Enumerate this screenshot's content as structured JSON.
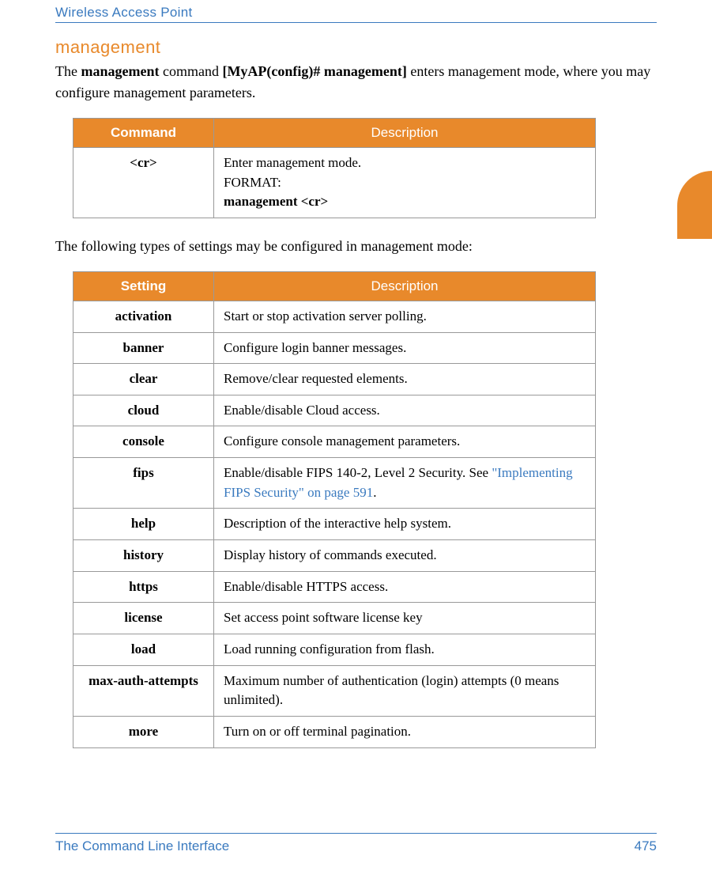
{
  "header": {
    "title": "Wireless Access Point"
  },
  "section": {
    "heading": "management",
    "intro_parts": [
      "The ",
      "management",
      " command ",
      "[MyAP(config)# management]",
      " enters management mode, where you may configure management parameters."
    ]
  },
  "table1": {
    "head": {
      "c1": "Command",
      "c2": "Description"
    },
    "row": {
      "name": "<cr>",
      "desc_line": "Enter management mode.",
      "fmt_label": "FORMAT:",
      "fmt_value": "management <cr>"
    }
  },
  "between_text": "The following types of settings may be configured in management mode:",
  "table2": {
    "head": {
      "c1": "Setting",
      "c2": "Description"
    },
    "rows": [
      {
        "name": "activation",
        "desc": "Start or stop activation server polling."
      },
      {
        "name": "banner",
        "desc": "Configure login banner messages."
      },
      {
        "name": "clear",
        "desc": "Remove/clear requested elements."
      },
      {
        "name": "cloud",
        "desc": "Enable/disable Cloud access."
      },
      {
        "name": "console",
        "desc": "Configure console management parameters."
      },
      {
        "name": "fips",
        "desc": "Enable/disable FIPS 140-2, Level 2 Security. See ",
        "link": "\"Implementing FIPS Security\" on page 591",
        "desc_after": "."
      },
      {
        "name": "help",
        "desc": "Description of the interactive help system."
      },
      {
        "name": "history",
        "desc": "Display history of commands executed."
      },
      {
        "name": "https",
        "desc": "Enable/disable HTTPS access."
      },
      {
        "name": "license",
        "desc": "Set access point software license key"
      },
      {
        "name": "load",
        "desc": "Load running configuration from flash."
      },
      {
        "name": "max-auth-attempts",
        "desc": "Maximum number of authentication (login) attempts (0 means unlimited)."
      },
      {
        "name": "more",
        "desc": "Turn on or off terminal pagination."
      }
    ]
  },
  "footer": {
    "left": "The Command Line Interface",
    "right": "475"
  }
}
